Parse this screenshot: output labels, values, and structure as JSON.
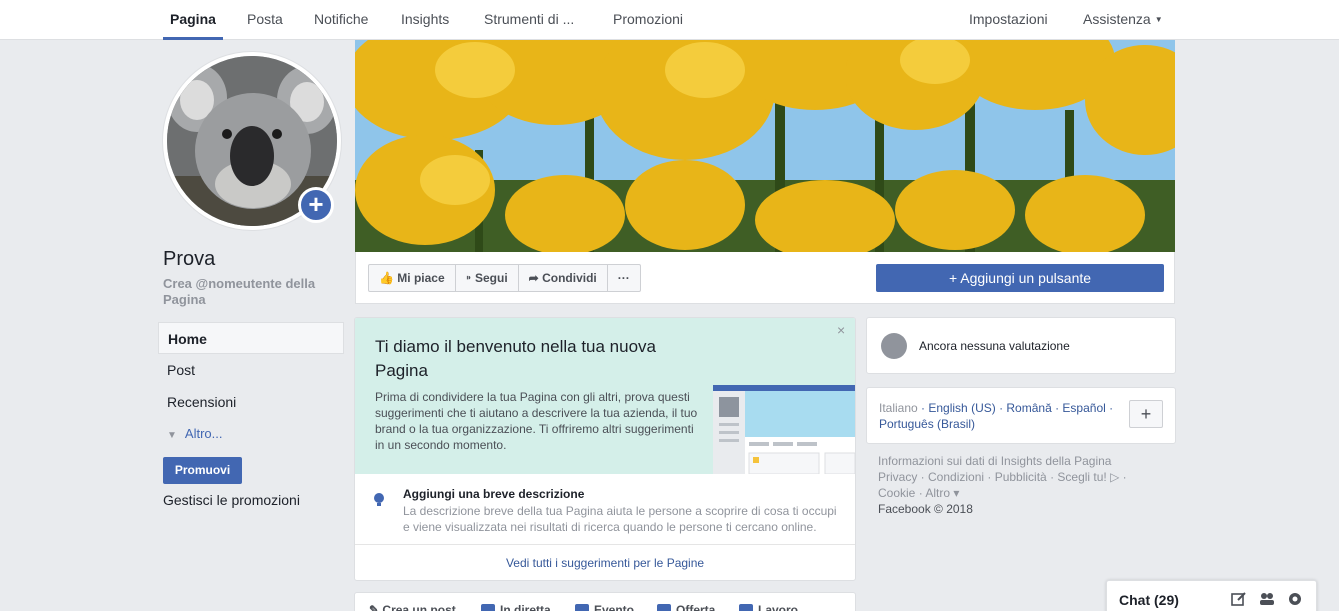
{
  "tabs": [
    {
      "label": "Pagina",
      "active": true
    },
    {
      "label": "Posta"
    },
    {
      "label": "Notifiche"
    },
    {
      "label": "Insights"
    },
    {
      "label": "Strumenti di ..."
    },
    {
      "label": "Promozioni"
    }
  ],
  "right_tabs": {
    "settings": "Impostazioni",
    "help": "Assistenza"
  },
  "page": {
    "name": "Prova",
    "username_prompt": "Crea @nomeutente della Pagina"
  },
  "left_nav": {
    "home": "Home",
    "post": "Post",
    "reviews": "Recensioni",
    "more": "Altro..."
  },
  "promote": {
    "button": "Promuovi",
    "manage": "Gestisci le promozioni"
  },
  "actions": {
    "like": "Mi piace",
    "follow": "Segui",
    "share": "Condividi",
    "more": "···",
    "add_button": "Aggiungi un pulsante"
  },
  "welcome": {
    "title": "Ti diamo il benvenuto nella tua nuova Pagina",
    "body": "Prima di condividere la tua Pagina con gli altri, prova questi suggerimenti che ti aiutano a descrivere la tua azienda, il tuo brand o la tua organizzazione. Ti offriremo altri suggerimenti in un secondo momento.",
    "close": "×",
    "suggestion_title": "Aggiungi una breve descrizione",
    "suggestion_body": "La descrizione breve della tua Pagina aiuta le persone a scoprire di cosa ti occupi e viene visualizzata nei risultati di ricerca quando le persone ti cercano online.",
    "see_all": "Vedi tutti i suggerimenti per le Pagine"
  },
  "composer": {
    "create_post": "Crea un post",
    "live": "In diretta",
    "event": "Evento",
    "offer": "Offerta",
    "job": "Lavoro"
  },
  "rating": {
    "text": "Ancora nessuna valutazione"
  },
  "languages": {
    "current": "Italiano",
    "others": "English (US) · Română · Español · Português (Brasil)",
    "add": "+"
  },
  "footer": {
    "line1": "Informazioni sui dati di Insights della Pagina",
    "line2": "Privacy · Condizioni · Pubblicità · Scegli tu! ▷ ·",
    "line3": "Cookie · Altro ▾",
    "copyright": "Facebook © 2018"
  },
  "chat": {
    "label": "Chat (29)"
  },
  "colors": {
    "brand": "#4267b2",
    "background": "#e9ebee",
    "welcome_bg": "#d4efe9",
    "link": "#365899"
  }
}
